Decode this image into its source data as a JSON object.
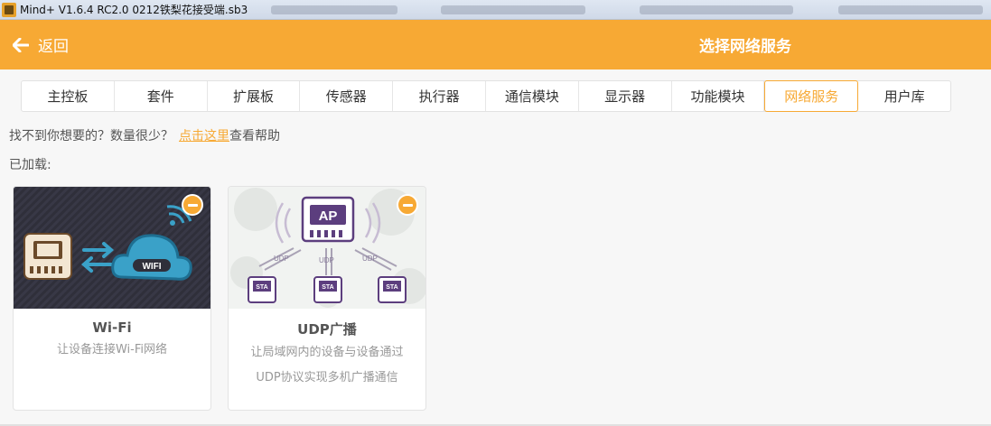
{
  "window": {
    "title": "Mind+ V1.6.4 RC2.0   0212铁梨花接受端.sb3"
  },
  "header": {
    "back_label": "返回",
    "title": "选择网络服务"
  },
  "tabs": [
    {
      "label": "主控板"
    },
    {
      "label": "套件"
    },
    {
      "label": "扩展板"
    },
    {
      "label": "传感器"
    },
    {
      "label": "执行器"
    },
    {
      "label": "通信模块"
    },
    {
      "label": "显示器"
    },
    {
      "label": "功能模块"
    },
    {
      "label": "网络服务",
      "active": true
    },
    {
      "label": "用户库"
    }
  ],
  "help": {
    "prefix": "找不到你想要的？数量很少？",
    "link": "点击这里",
    "suffix": "查看帮助"
  },
  "loaded_label": "已加载:",
  "cards": [
    {
      "name": "Wi-Fi",
      "desc_lines": [
        "让设备连接Wi-Fi网络"
      ],
      "image_text": "WIFI"
    },
    {
      "name": "UDP广播",
      "desc_lines": [
        "让局域网内的设备与设备通过",
        "UDP协议实现多机广播通信"
      ],
      "image_labels": {
        "ap": "AP",
        "udp": "UDP",
        "sta": "STA"
      }
    }
  ],
  "colors": {
    "accent": "#f7a934",
    "wifi_bg": "#2f2f3a",
    "cloud": "#3aa1c8",
    "udp_purple": "#6a4a8c"
  }
}
